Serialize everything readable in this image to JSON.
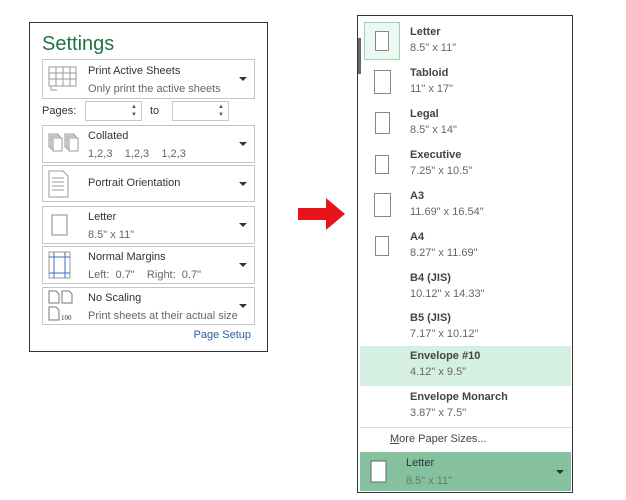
{
  "settings": {
    "title": "Settings",
    "print_what": {
      "label": "Print Active Sheets",
      "sub": "Only print the active sheets"
    },
    "pages_label": "Pages:",
    "to_label": "to",
    "pages_from": "",
    "pages_to": "",
    "collated": {
      "label": "Collated",
      "sub": "1,2,3    1,2,3    1,2,3"
    },
    "orientation": {
      "label": "Portrait Orientation"
    },
    "paper": {
      "label": "Letter",
      "sub": "8.5\" x 11\""
    },
    "margins": {
      "label": "Normal Margins",
      "sub": "Left:  0.7\"    Right:  0.7\""
    },
    "scaling": {
      "label": "No Scaling",
      "sub": "Print sheets at their actual size",
      "icon_text": "100"
    },
    "page_setup": "Page Setup"
  },
  "arrow_color": "#e8141b",
  "paper_menu": {
    "items": [
      {
        "name": "Letter",
        "size": "8.5\" x 11\"",
        "selected": true
      },
      {
        "name": "Tabloid",
        "size": "11\" x 17\""
      },
      {
        "name": "Legal",
        "size": "8.5\" x 14\""
      },
      {
        "name": "Executive",
        "size": "7.25\" x 10.5\""
      },
      {
        "name": "A3",
        "size": "11.69\" x 16.54\""
      },
      {
        "name": "A4",
        "size": "8.27\" x 11.69\""
      },
      {
        "name": "B4 (JIS)",
        "size": "10.12\" x 14.33\""
      },
      {
        "name": "B5 (JIS)",
        "size": "7.17\" x 10.12\""
      },
      {
        "name": "Envelope #10",
        "size": "4.12\" x 9.5\"",
        "hovered": true
      },
      {
        "name": "Envelope Monarch",
        "size": "3.87\" x 7.5\""
      }
    ],
    "more": "More Paper Sizes...",
    "current": {
      "label": "Letter",
      "sub": "8.5\" x 11\""
    }
  },
  "colors": {
    "accent": "#217346",
    "hover": "#d5efe2",
    "current_bg": "#86c19f",
    "link": "#2e5f9e"
  }
}
